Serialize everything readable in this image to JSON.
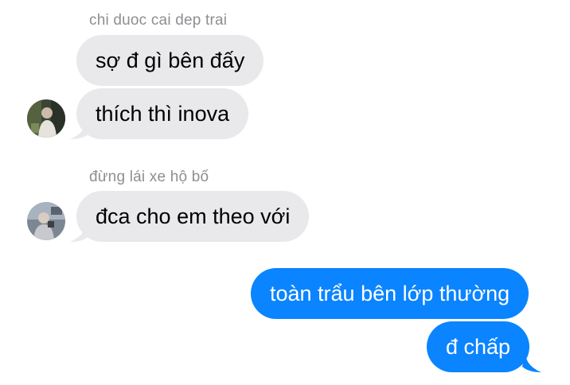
{
  "conversation": {
    "group_1": {
      "sender_name": "chi duoc cai dep trai",
      "messages": [
        "sợ đ gì bên đấy",
        "thích thì inova"
      ]
    },
    "group_2": {
      "sender_name": "đừng lái xe hộ bố",
      "messages": [
        "đca cho em theo với"
      ]
    },
    "outgoing": {
      "messages": [
        "toàn trẩu bên lớp thường",
        "đ chấp"
      ]
    }
  },
  "colors": {
    "incoming_bubble": "#e9e9eb",
    "outgoing_bubble": "#0a84ff",
    "sender_name": "#8e8e93"
  }
}
